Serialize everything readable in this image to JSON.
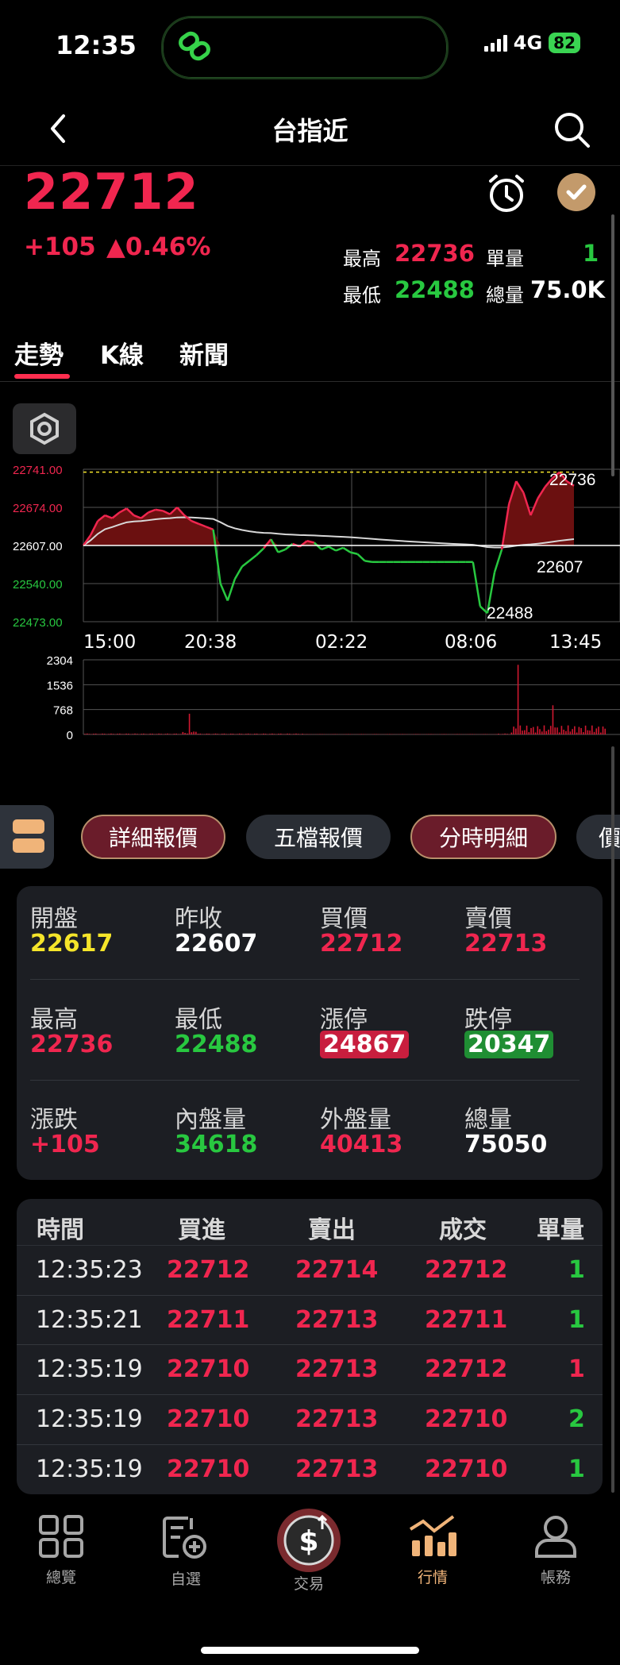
{
  "status": {
    "time": "12:35",
    "network": "4G",
    "battery": "82"
  },
  "nav": {
    "title": "台指近",
    "back_icon": "chevron-left-icon",
    "search_icon": "search-icon"
  },
  "quote": {
    "price": "22712",
    "change": "+105",
    "percent": "▲0.46%",
    "high_label": "最高",
    "high": "22736",
    "unit_label": "單量",
    "unit": "1",
    "low_label": "最低",
    "low": "22488",
    "total_label": "總量",
    "total": "75.0K"
  },
  "tabs": [
    {
      "label": "走勢"
    },
    {
      "label": "K線"
    },
    {
      "label": "新聞"
    }
  ],
  "chart_data": [
    {
      "type": "line",
      "y_tick_labels": [
        "22741.00",
        "22674.00",
        "22607.00",
        "22540.00",
        "22473.00"
      ],
      "ylim": [
        22473,
        22741
      ],
      "x_tick_labels": [
        "15:00",
        "20:38",
        "02:22",
        "08:06",
        "13:45"
      ],
      "reference_price": 22607,
      "annotations": [
        "22736",
        "22607",
        "22488"
      ],
      "series": [
        {
          "values": [
            22607,
            22625,
            22650,
            22660,
            22655,
            22665,
            22672,
            22660,
            22655,
            22665,
            22670,
            22668,
            22662,
            22674,
            22660,
            22650,
            22645,
            22640,
            22635,
            22540,
            22510,
            22548,
            22570,
            22580,
            22590,
            22602,
            22618,
            22595,
            22600,
            22610,
            22605,
            22615,
            22612,
            22600,
            22605,
            22598,
            22603,
            22595,
            22592,
            22580,
            22578,
            22578,
            22578,
            22578,
            22578,
            22578,
            22578,
            22578,
            22578,
            22578,
            22578,
            22578,
            22578,
            22578,
            22578,
            22500,
            22488,
            22560,
            22600,
            22680,
            22720,
            22700,
            22660,
            22690,
            22710,
            22725,
            22736,
            22720,
            22712
          ]
        }
      ]
    },
    {
      "type": "bar",
      "y_tick_labels": [
        "2304",
        "1536",
        "768",
        "0"
      ],
      "ylim": [
        0,
        2304
      ]
    }
  ],
  "chips": [
    {
      "label": "詳細報價"
    },
    {
      "label": "五檔報價"
    },
    {
      "label": "分時明細"
    },
    {
      "label": "價"
    }
  ],
  "detail": [
    [
      {
        "label": "開盤",
        "value": "22617"
      },
      {
        "label": "昨收",
        "value": "22607"
      },
      {
        "label": "買價",
        "value": "22712"
      },
      {
        "label": "賣價",
        "value": "22713"
      }
    ],
    [
      {
        "label": "最高",
        "value": "22736"
      },
      {
        "label": "最低",
        "value": "22488"
      },
      {
        "label": "漲停",
        "value": "24867"
      },
      {
        "label": "跌停",
        "value": "20347"
      }
    ],
    [
      {
        "label": "漲跌",
        "value": "+105"
      },
      {
        "label": "內盤量",
        "value": "34618"
      },
      {
        "label": "外盤量",
        "value": "40413"
      },
      {
        "label": "總量",
        "value": "75050"
      }
    ]
  ],
  "ticks": {
    "headers": [
      "時間",
      "買進",
      "賣出",
      "成交",
      "單量"
    ],
    "rows": [
      [
        "12:35:23",
        "22712",
        "22714",
        "22712",
        "1"
      ],
      [
        "12:35:21",
        "22711",
        "22713",
        "22711",
        "1"
      ],
      [
        "12:35:19",
        "22710",
        "22713",
        "22712",
        "1"
      ],
      [
        "12:35:19",
        "22710",
        "22713",
        "22710",
        "2"
      ],
      [
        "12:35:19",
        "22710",
        "22713",
        "22710",
        "1"
      ]
    ]
  },
  "colors": {
    "up": "#f0264f",
    "down": "#28c840",
    "accent": "#f0b479"
  },
  "bottom_nav": [
    {
      "label": "總覽",
      "icon": "grid-icon"
    },
    {
      "label": "自選",
      "icon": "watchlist-add-icon"
    },
    {
      "label": "交易",
      "icon": "trade-dollar-icon"
    },
    {
      "label": "行情",
      "icon": "market-chart-icon"
    },
    {
      "label": "帳務",
      "icon": "account-user-icon"
    }
  ]
}
